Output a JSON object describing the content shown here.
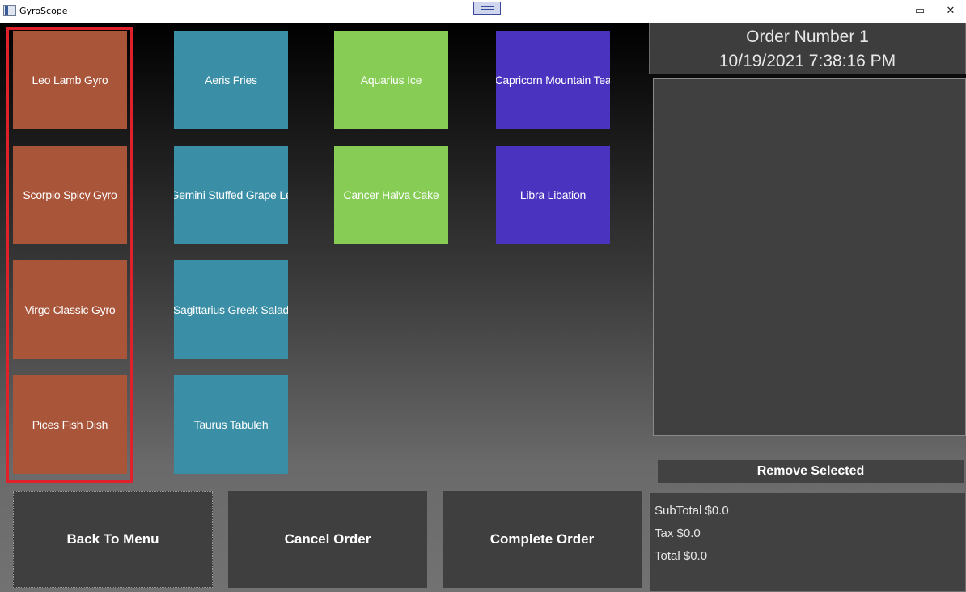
{
  "window": {
    "title": "GyroScope",
    "min": "–",
    "max": "▭",
    "close": "✕"
  },
  "menu": {
    "gyros": [
      "Leo Lamb Gyro",
      "Scorpio Spicy Gyro",
      "Virgo Classic Gyro",
      "Pices Fish Dish"
    ],
    "sides": [
      "Aeris Fries",
      "Gemini Stuffed Grape Le",
      "Sagittarius Greek Salad",
      "Taurus Tabuleh"
    ],
    "desserts": [
      "Aquarius Ice",
      "Cancer Halva Cake"
    ],
    "drinks": [
      "Capricorn Mountain Tea",
      "Libra Libation"
    ]
  },
  "order": {
    "number": "Order Number 1",
    "datetime": "10/19/2021 7:38:16 PM",
    "remove_label": "Remove Selected",
    "subtotal": "SubTotal $0.0",
    "tax": "Tax $0.0",
    "total": "Total $0.0"
  },
  "actions": {
    "back": "Back To Menu",
    "cancel": "Cancel Order",
    "complete": "Complete Order"
  },
  "colors": {
    "gyro": "#a9553a",
    "side": "#3a8ea6",
    "dessert": "#86cc55",
    "drink": "#4a34bf",
    "highlight": "#e0202a"
  }
}
